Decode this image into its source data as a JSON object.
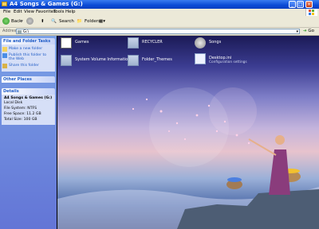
{
  "window": {
    "title": "A4 Songs & Games (G:)"
  },
  "menu": [
    "File",
    "Edit",
    "View",
    "Favorites",
    "Tools",
    "Help"
  ],
  "toolbar": {
    "back": "Back",
    "search": "Search",
    "folders": "Folders"
  },
  "address": {
    "label": "Address",
    "value": "G:\\",
    "go": "Go"
  },
  "sidebar": {
    "tasks_title": "File and Folder Tasks",
    "tasks": [
      "Make a new folder",
      "Publish this folder to the Web",
      "Share this folder"
    ],
    "other_places_title": "Other Places",
    "details_title": "Details",
    "details": {
      "name": "A4 Songs & Games (G:)",
      "type": "Local Disk",
      "fs": "File System: NTFS",
      "free": "Free Space: 11.2 GB",
      "total": "Total Size: 100 GB"
    }
  },
  "files": [
    {
      "name": "Games",
      "icon": "games-folder-icon"
    },
    {
      "name": "RECYCLER",
      "icon": "folder-icon"
    },
    {
      "name": "Songs",
      "icon": "music-folder-icon"
    },
    {
      "name": "System Volume Information",
      "icon": "folder-icon"
    },
    {
      "name": "Folder_Themes",
      "icon": "folder-icon"
    },
    {
      "name": "Desktop.ini",
      "icon": "settings-file-icon",
      "sub": "Configuration settings"
    }
  ]
}
